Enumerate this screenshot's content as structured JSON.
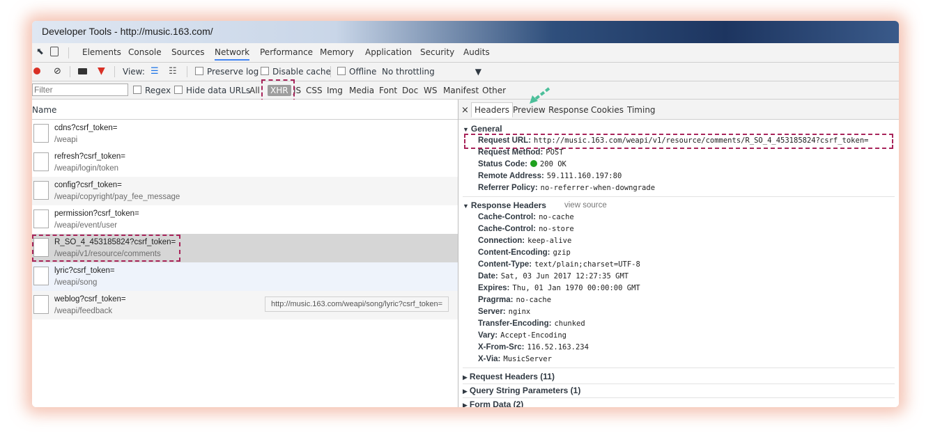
{
  "window": {
    "title": "Developer Tools - http://music.163.com/"
  },
  "tabs": [
    "Elements",
    "Console",
    "Sources",
    "Network",
    "Performance",
    "Memory",
    "Application",
    "Security",
    "Audits"
  ],
  "toolbar": {
    "view_label": "View:",
    "preserve_log": "Preserve log",
    "disable_cache": "Disable cache",
    "offline": "Offline",
    "throttling": "No throttling"
  },
  "filterbar": {
    "filter_placeholder": "Filter",
    "regex": "Regex",
    "hide_data_urls": "Hide data URLs",
    "types": [
      "All",
      "XHR",
      "JS",
      "CSS",
      "Img",
      "Media",
      "Font",
      "Doc",
      "WS",
      "Manifest",
      "Other"
    ]
  },
  "requests": {
    "header": "Name",
    "rows": [
      {
        "name": "cdns?csrf_token=",
        "path": "/weapi"
      },
      {
        "name": "refresh?csrf_token=",
        "path": "/weapi/login/token"
      },
      {
        "name": "config?csrf_token=",
        "path": "/weapi/copyright/pay_fee_message"
      },
      {
        "name": "permission?csrf_token=",
        "path": "/weapi/event/user"
      },
      {
        "name": "R_SO_4_453185824?csrf_token=",
        "path": "/weapi/v1/resource/comments"
      },
      {
        "name": "lyric?csrf_token=",
        "path": "/weapi/song"
      },
      {
        "name": "weblog?csrf_token=",
        "path": "/weapi/feedback"
      }
    ],
    "tooltip": "http://music.163.com/weapi/song/lyric?csrf_token="
  },
  "detail": {
    "close": "×",
    "tabs": [
      "Headers",
      "Preview",
      "Response",
      "Cookies",
      "Timing"
    ],
    "general": {
      "title": "General",
      "items": [
        {
          "k": "Request URL:",
          "v": "http://music.163.com/weapi/v1/resource/comments/R_SO_4_453185824?csrf_token="
        },
        {
          "k": "Request Method:",
          "v": "POST"
        },
        {
          "k": "Status Code:",
          "v": "200 OK"
        },
        {
          "k": "Remote Address:",
          "v": "59.111.160.197:80"
        },
        {
          "k": "Referrer Policy:",
          "v": "no-referrer-when-downgrade"
        }
      ]
    },
    "response_headers": {
      "title": "Response Headers",
      "view_source": "view source",
      "items": [
        {
          "k": "Cache-Control:",
          "v": "no-cache"
        },
        {
          "k": "Cache-Control:",
          "v": "no-store"
        },
        {
          "k": "Connection:",
          "v": "keep-alive"
        },
        {
          "k": "Content-Encoding:",
          "v": "gzip"
        },
        {
          "k": "Content-Type:",
          "v": "text/plain;charset=UTF-8"
        },
        {
          "k": "Date:",
          "v": "Sat, 03 Jun 2017 12:27:35 GMT"
        },
        {
          "k": "Expires:",
          "v": "Thu, 01 Jan 1970 00:00:00 GMT"
        },
        {
          "k": "Pragrma:",
          "v": "no-cache"
        },
        {
          "k": "Server:",
          "v": "nginx"
        },
        {
          "k": "Transfer-Encoding:",
          "v": "chunked"
        },
        {
          "k": "Vary:",
          "v": "Accept-Encoding"
        },
        {
          "k": "X-From-Src:",
          "v": "116.52.163.234"
        },
        {
          "k": "X-Via:",
          "v": "MusicServer"
        }
      ]
    },
    "collapsed": [
      "Request Headers (11)",
      "Query String Parameters (1)",
      "Form Data (2)"
    ]
  },
  "colors": {
    "highlight_dash": "#a8245a",
    "accent_blue": "#4285f4",
    "arrow_green": "#4cbf9a",
    "status_green": "#1fa11f"
  }
}
